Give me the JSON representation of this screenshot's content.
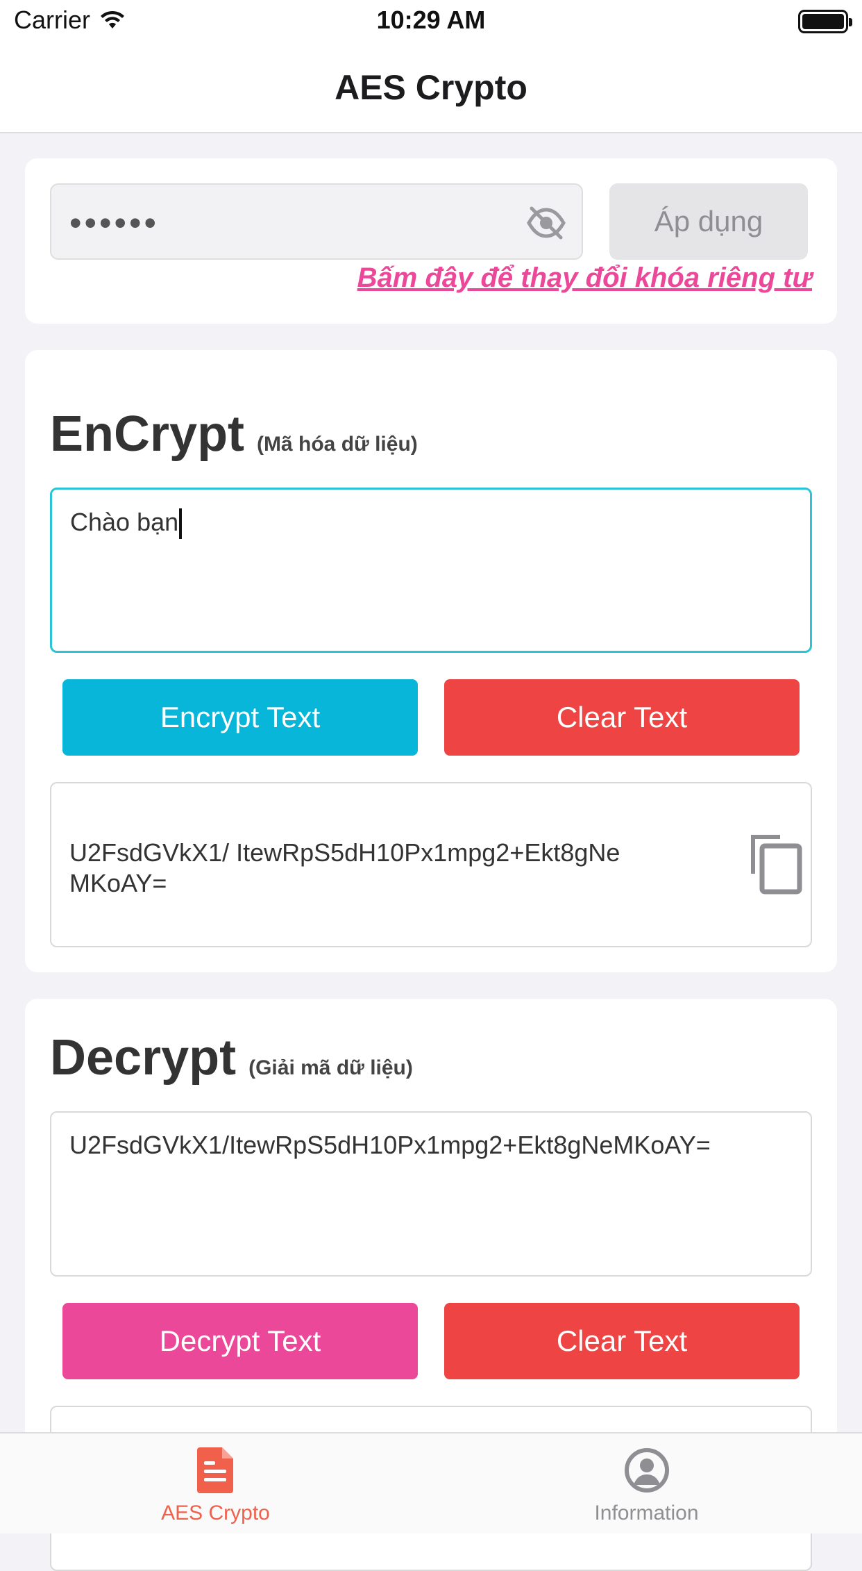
{
  "status_bar": {
    "carrier": "Carrier",
    "time": "10:29 AM"
  },
  "nav": {
    "title": "AES Crypto"
  },
  "key_section": {
    "key_value_masked": "••••••",
    "apply_label": "Áp dụng",
    "change_key_link": "Bấm đây để thay đổi khóa riêng tư"
  },
  "encrypt_section": {
    "title": "EnCrypt",
    "subtitle": "(Mã hóa dữ liệu)",
    "input_value": "Chào bạn",
    "encrypt_button": "Encrypt Text",
    "clear_button": "Clear Text",
    "result_text": "U2FsdGVkX1/ ItewRpS5dH10Px1mpg2+Ekt8gNeMKoAY="
  },
  "decrypt_section": {
    "title": "Decrypt",
    "subtitle": "(Giải mã dữ liệu)",
    "input_value": "U2FsdGVkX1/ItewRpS5dH10Px1mpg2+Ekt8gNeMKoAY=",
    "decrypt_button": "Decrypt Text",
    "clear_button": "Clear Text"
  },
  "tab_bar": {
    "tabs": [
      {
        "label": "AES Crypto",
        "icon": "document-icon",
        "active": true
      },
      {
        "label": "Information",
        "icon": "user-circle-icon",
        "active": false
      }
    ]
  },
  "colors": {
    "accent_cyan": "#08b6d9",
    "danger_red": "#ef4444",
    "pink": "#ec4899",
    "tab_active": "#f0604a"
  }
}
